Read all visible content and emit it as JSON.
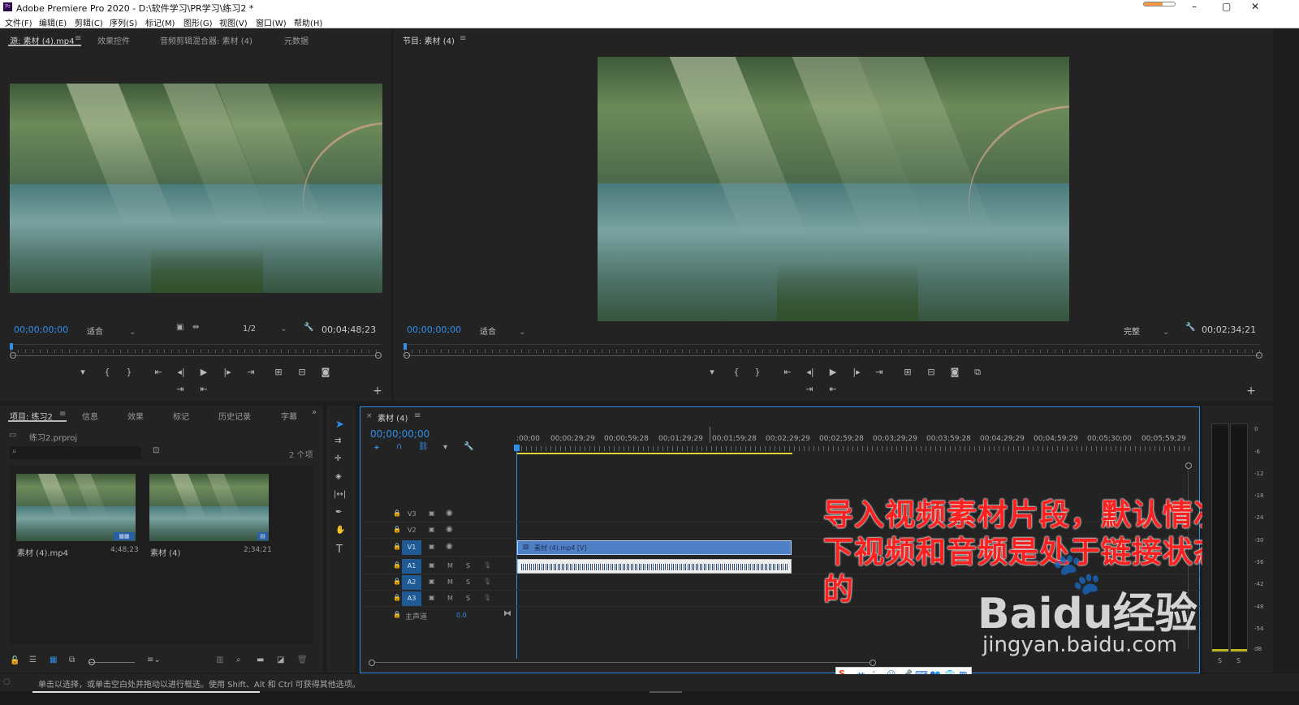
{
  "app": {
    "title": "Adobe Premiere Pro 2020 - D:\\软件学习\\PR学习\\练习2 *",
    "logo": "Pr",
    "window_controls": [
      "–",
      "▢",
      "✕"
    ]
  },
  "menu": [
    "文件(F)",
    "编辑(E)",
    "剪辑(C)",
    "序列(S)",
    "标记(M)",
    "图形(G)",
    "视图(V)",
    "窗口(W)",
    "帮助(H)"
  ],
  "source_panel": {
    "tabs": [
      "源: 素材 (4).mp4",
      "效果控件",
      "音频剪辑混合器: 素材 (4)",
      "元数据"
    ],
    "timecode": "00;00;00;00",
    "fit": "适合",
    "resolution": "1/2",
    "duration": "00;04;48;23",
    "playhead": 0.0
  },
  "program_panel": {
    "tab": "节目: 素材 (4)",
    "timecode": "00;00;00;00",
    "fit": "适合",
    "quality": "完整",
    "duration": "00;02;34;21",
    "playhead": 0.0
  },
  "project_panel": {
    "tabs": [
      "项目: 练习2",
      "信息",
      "效果",
      "标记",
      "历史记录",
      "字幕"
    ],
    "file": "练习2.prproj",
    "search_placeholder": "",
    "item_count": "2 个项",
    "items": [
      {
        "name": "素材 (4).mp4",
        "duration": "4;48;23"
      },
      {
        "name": "素材 (4)",
        "duration": "2;34;21"
      }
    ]
  },
  "timeline": {
    "tab": "素材 (4)",
    "timecode": "00;00;00;00",
    "ruler": [
      ":00;00",
      "00;00;29;29",
      "00;00;59;28",
      "00;01;29;29",
      "00;01;59;28",
      "00;02;29;29",
      "00;02;59;28",
      "00;03;29;29",
      "00;03;59;28",
      "00;04;29;29",
      "00;04;59;29",
      "00;05;30;00",
      "00;05;59;29"
    ],
    "video_tracks": [
      "V3",
      "V2",
      "V1"
    ],
    "audio_tracks": [
      "A1",
      "A2",
      "A3"
    ],
    "master": "主声道",
    "master_value": "0.0",
    "mute_label": "M",
    "solo_label": "S",
    "video_clip": "素材 (4).mp4 [V]"
  },
  "meter": {
    "ticks": [
      "0",
      "-6",
      "-12",
      "-18",
      "-24",
      "-30",
      "-36",
      "-42",
      "-48",
      "-54",
      "dB"
    ],
    "solo": [
      "S",
      "S"
    ]
  },
  "annotation": {
    "lines": [
      "导入视频素材片段，默认情况",
      "下视频和音频是处于链接状态",
      "的"
    ]
  },
  "watermark": {
    "brand": "Baidu经验",
    "url": "jingyan.baidu.com"
  },
  "ime_bar": {
    "lang": "英"
  },
  "status": {
    "text": "单击以选择，或单击空白处并拖动以进行框选。使用 Shift、Alt 和 Ctrl 可获得其他选项。"
  },
  "colors": {
    "accent": "#2f8ee8",
    "clip_video": "#4f7fc4",
    "annotation": "#ff2020",
    "track_patch": "#1f5a94"
  }
}
